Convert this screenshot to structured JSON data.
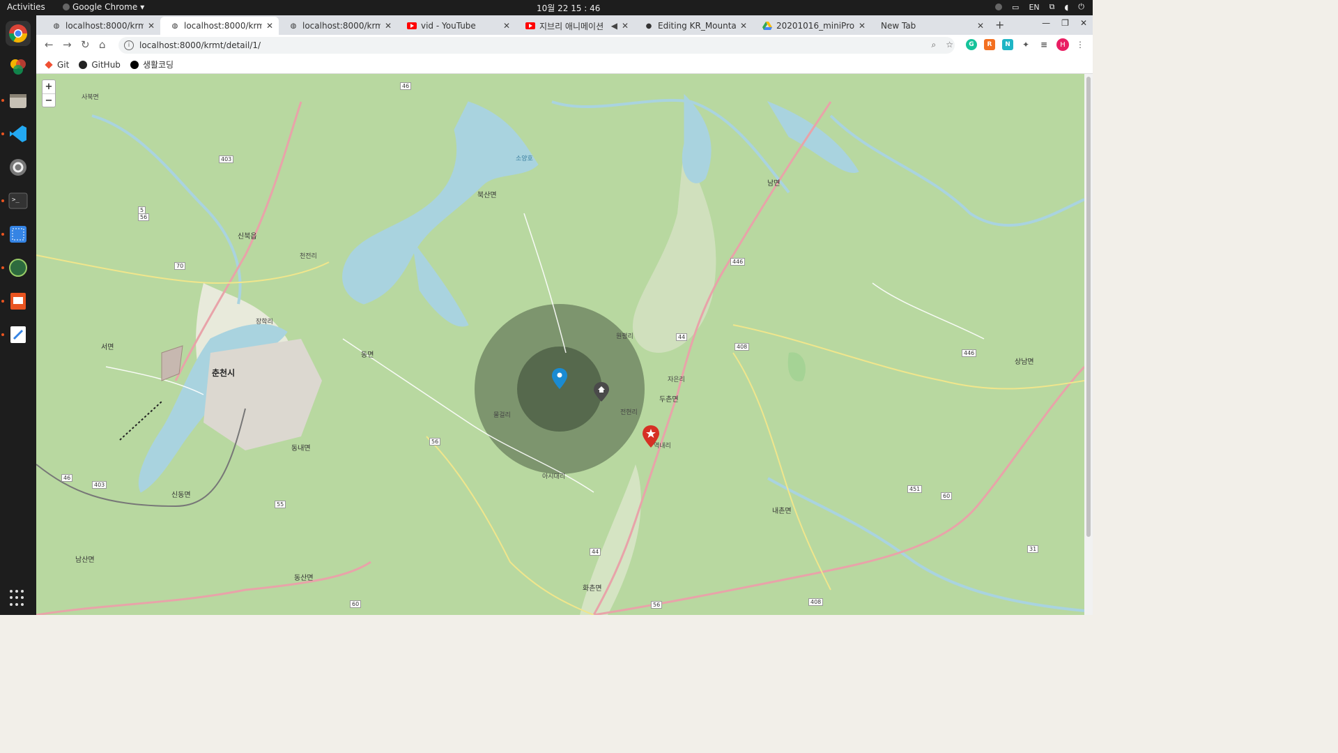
{
  "system": {
    "activities": "Activities",
    "app_name": "Google Chrome",
    "clock": "10월 22  15 : 46",
    "language": "EN"
  },
  "tabs": [
    {
      "label": "localhost:8000/krmt/"
    },
    {
      "label": "localhost:8000/krmt/"
    },
    {
      "label": "localhost:8000/krmt/"
    },
    {
      "label": "vid - YouTube"
    },
    {
      "label": "지브리 애니메이션"
    },
    {
      "label": "Editing KR_Mountain"
    },
    {
      "label": "20201016_miniProjec"
    },
    {
      "label": "New Tab"
    }
  ],
  "address": {
    "url": "localhost:8000/krmt/detail/1/"
  },
  "bookmarks": [
    {
      "label": "Git"
    },
    {
      "label": "GitHub"
    },
    {
      "label": "생활코딩"
    }
  ],
  "map": {
    "zoom_in": "+",
    "zoom_out": "−",
    "places": [
      {
        "label": "사북면"
      },
      {
        "label": "신북읍"
      },
      {
        "label": "서면"
      },
      {
        "label": "춘천시"
      },
      {
        "label": "동내면"
      },
      {
        "label": "신동면"
      },
      {
        "label": "남산면"
      },
      {
        "label": "동산면"
      },
      {
        "label": "북산면"
      },
      {
        "label": "소양호"
      },
      {
        "label": "동면"
      },
      {
        "label": "남면"
      },
      {
        "label": "두촌면"
      },
      {
        "label": "내촌면"
      },
      {
        "label": "화촌면"
      },
      {
        "label": "상남면"
      },
      {
        "label": "천전리"
      },
      {
        "label": "장학리"
      },
      {
        "label": "원평리"
      },
      {
        "label": "자은리"
      },
      {
        "label": "역내리"
      },
      {
        "label": "아시대리"
      },
      {
        "label": "물걸리"
      },
      {
        "label": "전현리"
      }
    ],
    "roads": [
      "46",
      "403",
      "5",
      "56",
      "70",
      "55",
      "56",
      "44",
      "408",
      "446",
      "451",
      "60",
      "31",
      "44",
      "408",
      "60",
      "56",
      "46",
      "403",
      "446"
    ]
  },
  "colors": {
    "pin_blue": "#1a8bd2",
    "pin_red": "#d63024",
    "circle": "#4d5e45"
  }
}
